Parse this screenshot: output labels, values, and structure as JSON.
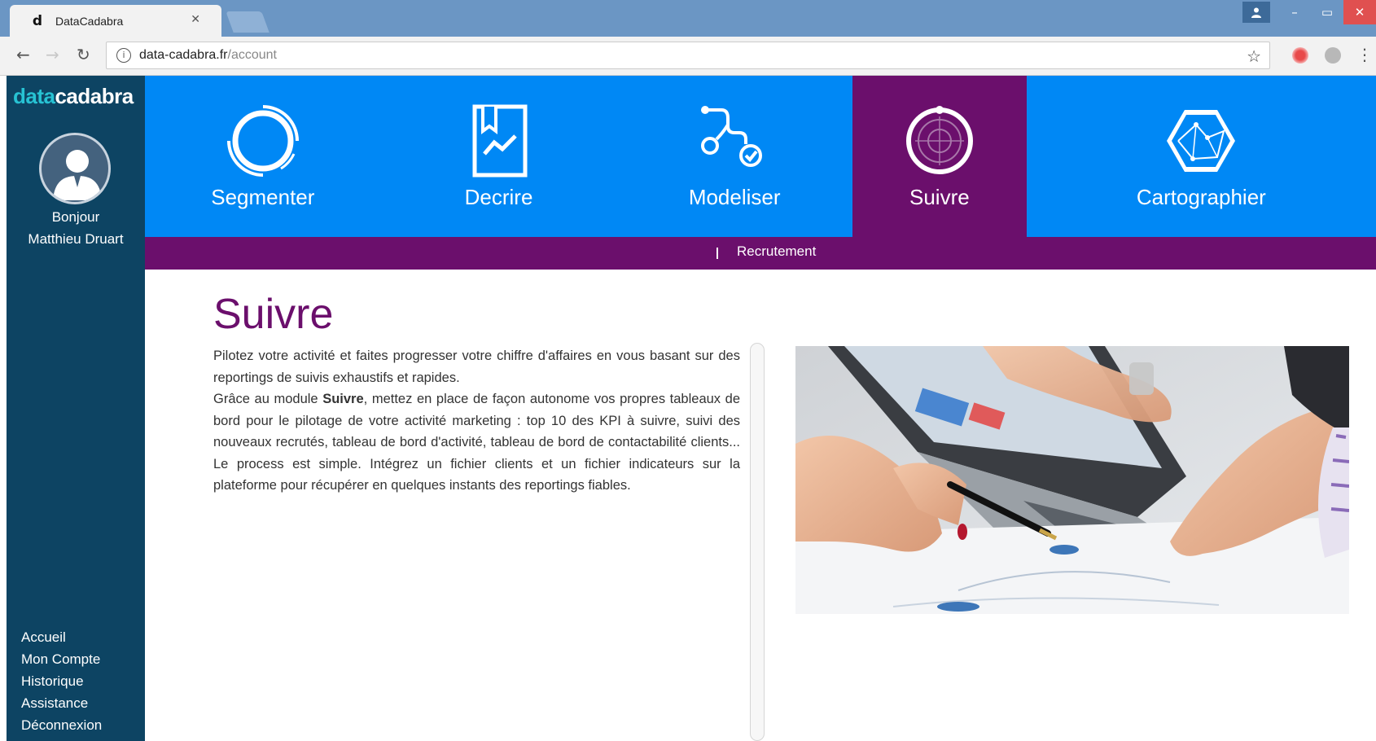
{
  "browser": {
    "tab_title": "DataCadabra",
    "tab_favicon": "d",
    "url_host": "data-cadabra.fr",
    "url_path": "/account"
  },
  "sidebar": {
    "logo_part1": "data",
    "logo_part2": "cadabra",
    "greeting_line1": "Bonjour",
    "greeting_line2": "Matthieu Druart",
    "menu": [
      "Accueil",
      "Mon Compte",
      "Historique",
      "Assistance",
      "Déconnexion"
    ]
  },
  "nav": {
    "items": [
      {
        "label": "Segmenter",
        "icon": "segment-ring-icon"
      },
      {
        "label": "Decrire",
        "icon": "chart-document-icon"
      },
      {
        "label": "Modeliser",
        "icon": "flow-check-icon"
      },
      {
        "label": "Suivre",
        "icon": "target-radar-icon",
        "active": true
      },
      {
        "label": "Cartographier",
        "icon": "hexagon-map-icon"
      }
    ],
    "sub_link": "Recrutement"
  },
  "main": {
    "title": "Suivre",
    "para1": "Pilotez votre activité et faites progresser votre chiffre d'affaires en vous basant sur des reportings de suivis exhaustifs et rapides.",
    "para2_before": "Grâce au module ",
    "para2_bold": "Suivre",
    "para2_after": ", mettez en place de façon autonome vos propres tableaux de bord pour le pilotage de votre activité marketing : top 10 des KPI à suivre, suivi des nouveaux recrutés, tableau de bord d'activité, tableau de bord de contactabilité clients... Le process est simple. Intégrez un fichier clients et un fichier indicateurs sur la plateforme pour récupérer en quelques instants des reportings fiables."
  },
  "colors": {
    "nav_blue": "#0088f5",
    "active_purple": "#6b0f6c",
    "sidebar_navy": "#0d4463",
    "logo_accent": "#27c2d3"
  }
}
